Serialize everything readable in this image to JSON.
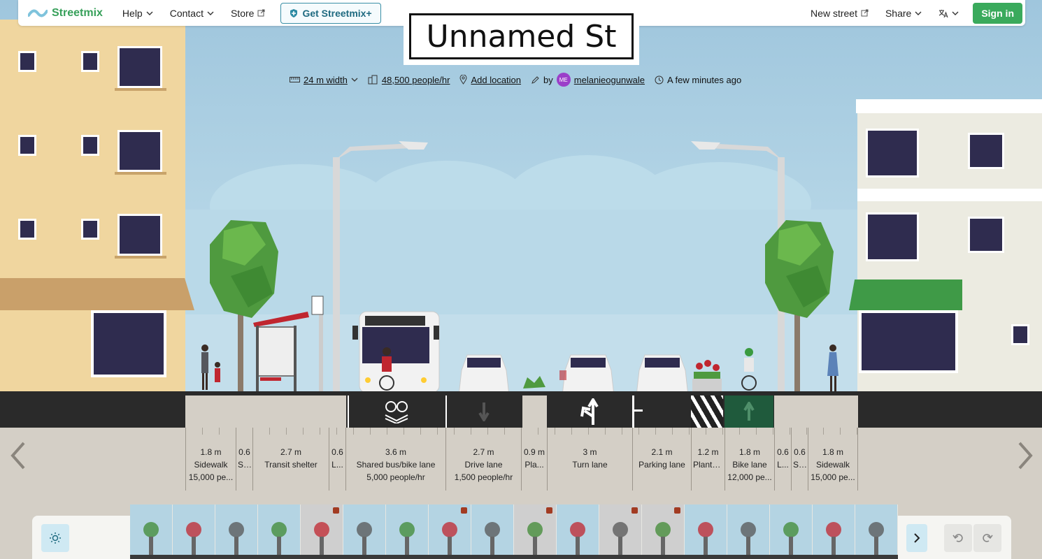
{
  "app": {
    "brand": "Streetmix",
    "nav": {
      "help": "Help",
      "contact": "Contact",
      "store": "Store",
      "get_plus": "Get Streetmix+"
    },
    "right": {
      "new_street": "New street",
      "share": "Share",
      "sign_in": "Sign in"
    }
  },
  "street": {
    "name": "Unnamed St",
    "width": "24 m width",
    "capacity": "48,500 people/hr",
    "location": "Add location",
    "by": "by",
    "author_initials": "ME",
    "author": "melanieogunwale",
    "updated": "A few minutes ago"
  },
  "segments": [
    {
      "width": "1.8 m",
      "name": "Sidewalk",
      "capacity": "15,000 pe..."
    },
    {
      "width": "0.6",
      "name": "Si...",
      "capacity": ""
    },
    {
      "width": "2.7 m",
      "name": "Transit shelter",
      "capacity": ""
    },
    {
      "width": "0.6",
      "name": "L...",
      "capacity": ""
    },
    {
      "width": "3.6 m",
      "name": "Shared bus/bike lane",
      "capacity": "5,000 people/hr"
    },
    {
      "width": "2.7 m",
      "name": "Drive lane",
      "capacity": "1,500 people/hr"
    },
    {
      "width": "0.9 m",
      "name": "Pla...",
      "capacity": ""
    },
    {
      "width": "3 m",
      "name": "Turn lane",
      "capacity": ""
    },
    {
      "width": "2.1 m",
      "name": "Parking lane",
      "capacity": ""
    },
    {
      "width": "1.2 m",
      "name": "Plante...",
      "capacity": ""
    },
    {
      "width": "1.8 m",
      "name": "Bike lane",
      "capacity": "12,000 pe..."
    },
    {
      "width": "0.6",
      "name": "L...",
      "capacity": ""
    },
    {
      "width": "0.6",
      "name": "Si...",
      "capacity": ""
    },
    {
      "width": "1.8 m",
      "name": "Sidewalk",
      "capacity": "15,000 pe..."
    }
  ],
  "bus_sign": "4",
  "colors": {
    "brand": "#3aaa5c",
    "asphalt": "#2a2a2a",
    "bike_lane": "#1f5a3c",
    "sidewalk": "#d4cfc6"
  },
  "palette_icons": [
    "pedestrians-icon",
    "tree-icon",
    "bicycle-icon",
    "bench-icon",
    "cafe-table-icon",
    "newspaper-box-icon",
    "lamp-post-icon",
    "utility-pole-icon",
    "planter-box-icon",
    "vendor-icon",
    "flowers-icon",
    "traffic-cone-icon",
    "drainage-icon",
    "pedestrian-scooter-icon",
    "e-scooter-icon",
    "cyclist-icon",
    "bikeshare-icon",
    "bus-icon"
  ]
}
